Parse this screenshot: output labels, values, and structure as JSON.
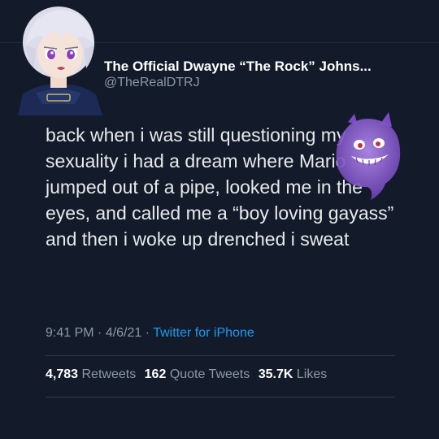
{
  "colors": {
    "background": "#131b2a",
    "text": "#e7e9ea",
    "muted": "#8b98a5",
    "link": "#1d9bf0"
  },
  "author": {
    "display_name": "The Official Dwayne “The Rock” Johns...",
    "handle": "@TheRealDTRJ",
    "avatar_icon": "anime-character-avatar",
    "sticker_icon": "purple-ghost-sticker"
  },
  "tweet": {
    "text_before": "back when i was still questioning my sexuality i had a dream where ",
    "text_highlight": "Mario",
    "text_after": " jumped out of a pipe, looked me in the eyes, and called me a “boy loving gayass” and then i woke up drenched i sweat"
  },
  "meta": {
    "time": "9:41 PM",
    "separator": " · ",
    "date": "4/6/21",
    "source": "Twitter for iPhone"
  },
  "stats": {
    "retweets_count": "4,783",
    "retweets_label": "Retweets",
    "quotes_count": "162",
    "quotes_label": "Quote Tweets",
    "likes_count": "35.7K",
    "likes_label": "Likes"
  }
}
